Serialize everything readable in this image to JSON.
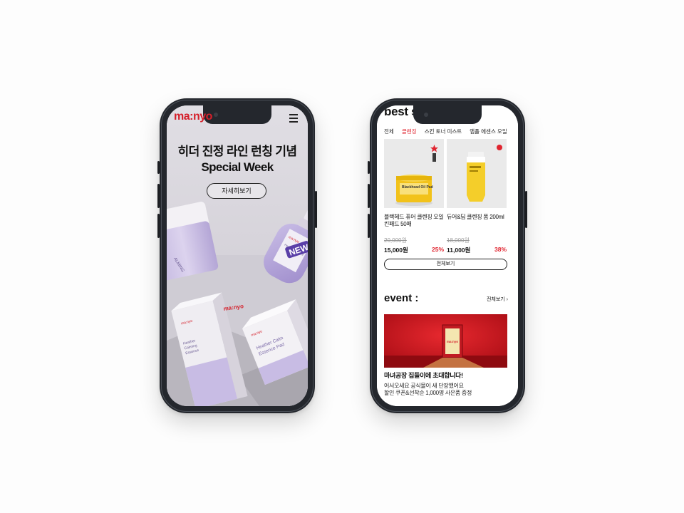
{
  "left_phone": {
    "logo": "ma:nyo",
    "hero_title_line1": "히더 진정 라인 런칭 기념",
    "hero_title_line2": "Special Week",
    "detail_button": "자세히보기",
    "product_texts": {
      "bottle_brand": "ma:nyo",
      "new_badge": "NEW",
      "box_brand": "ma:nyo",
      "box_name": "Heather Calming Essence",
      "pad_name": "Heather Calming Essence Pad"
    }
  },
  "right_phone": {
    "section_title": "best s",
    "tabs": [
      {
        "label": "전체",
        "active": false
      },
      {
        "label": "클렌징",
        "active": true
      },
      {
        "label": "스킨 토너 미스트",
        "active": false
      },
      {
        "label": "앰플 에센스 오일",
        "active": false
      }
    ],
    "products": [
      {
        "name": "블랙헤드 퓨어 클렌징 오일 킨패드 50매",
        "original_price": "20,000원",
        "price": "15,000원",
        "discount": "25%",
        "jar_label": "Blackhead Oil Pad"
      },
      {
        "name": "듀어&딥 클렌징 폼 200ml",
        "original_price": "18,000원",
        "price": "11,000원",
        "discount": "38%"
      }
    ],
    "view_all_button": "전체보기",
    "event": {
      "title": "event :",
      "more_link": "전체보기",
      "banner_brand": "ma:nyo",
      "heading": "마녀공장 집들이에 초대합니다!",
      "desc_line1": "어서오세요 공식몰이 새 단장했어요",
      "desc_line2": "할인 쿠폰&선착순 1,000명 사은품 증정"
    }
  },
  "colors": {
    "brand_red": "#d5202b",
    "discount_red": "#e0242f",
    "phone_frame": "#24272d",
    "lavender": "#b9acd8"
  }
}
